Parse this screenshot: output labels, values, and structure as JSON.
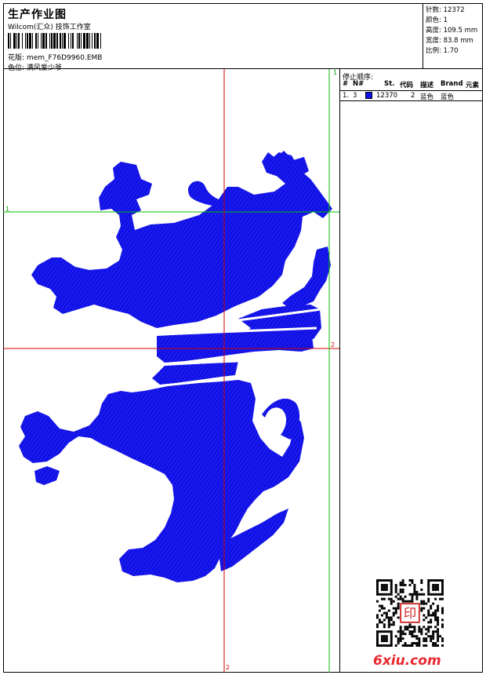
{
  "header": {
    "title": "生产作业图",
    "company": "Wilcom(汇众) 技饰工作室",
    "design_label": "花版:",
    "design_name": "mem_F76D9960.EMB",
    "colorway_label": "色位:",
    "colorway_name": "满风爱少爷"
  },
  "stats": [
    {
      "label": "针数:",
      "value": "12372"
    },
    {
      "label": "颜色:",
      "value": "1"
    },
    {
      "label": "高度:",
      "value": "109.5 mm"
    },
    {
      "label": "宽度:",
      "value": "83.8 mm"
    },
    {
      "label": "比例:",
      "value": "1.70"
    }
  ],
  "stop_sequence": {
    "title": "停止顺序:",
    "columns": [
      "#",
      "N#",
      "St.",
      "代码",
      "描述",
      "Brand",
      "元素"
    ],
    "rows": [
      {
        "index": "1.",
        "needle": "3",
        "color": "#1010e8",
        "stitches": "12370",
        "code": "2",
        "description": "蓝色",
        "brand": "蓝色",
        "element": ""
      }
    ]
  },
  "guides": {
    "h1": "1",
    "h2": "2",
    "v1": "1",
    "v2": "2"
  },
  "design_color": "#1010e8",
  "watermark": {
    "site": "6xiu.com",
    "seal": "印"
  }
}
